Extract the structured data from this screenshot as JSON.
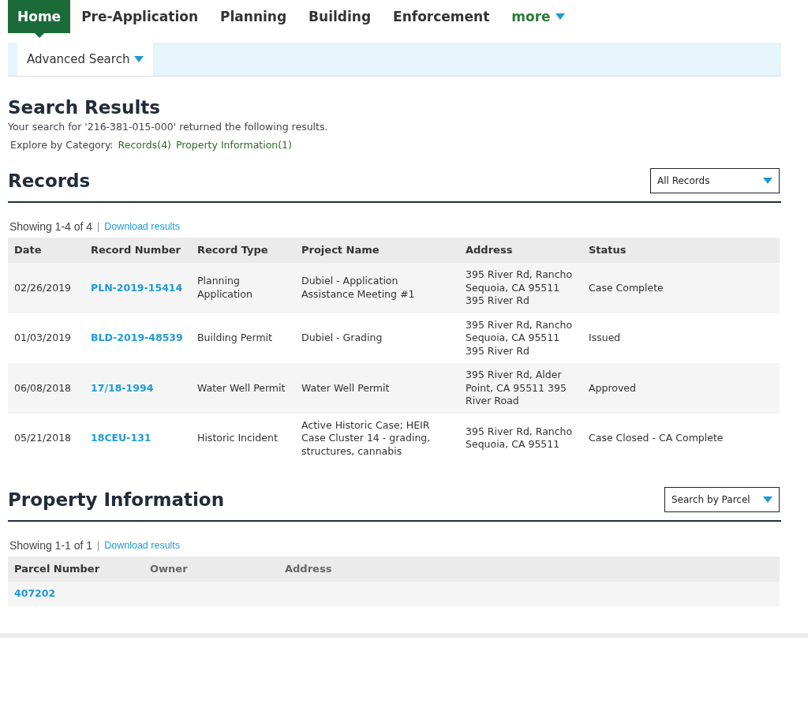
{
  "nav": {
    "tabs": [
      {
        "label": "Home",
        "kind": "link",
        "selected": true
      },
      {
        "label": "Pre-Application",
        "kind": "link",
        "selected": false
      },
      {
        "label": "Planning",
        "kind": "link",
        "selected": false
      },
      {
        "label": "Building",
        "kind": "link",
        "selected": false
      },
      {
        "label": "Enforcement",
        "kind": "link",
        "selected": false
      },
      {
        "label": "more",
        "kind": "menu",
        "selected": false
      }
    ],
    "subnav": {
      "label": "Advanced Search"
    }
  },
  "search_results": {
    "title": "Search Results",
    "summary": "Your search for '216-381-015-000' returned the following results.",
    "explore_label": "Explore by Category:",
    "categories": [
      "Records(4)",
      "Property Information(1)"
    ]
  },
  "records": {
    "title": "Records",
    "filter": "All Records",
    "showing": "Showing 1-4 of 4",
    "separator": "|",
    "download": "Download results",
    "columns": [
      "Date",
      "Record Number",
      "Record Type",
      "Project Name",
      "Address",
      "Status"
    ],
    "rows": [
      {
        "date": "02/26/2019",
        "number": "PLN-2019-15414",
        "type": "Planning Application",
        "project": "Dubiel - Application Assistance Meeting #1",
        "address": "395 River Rd, Rancho Sequoia, CA 95511 395 River Rd",
        "status": "Case Complete"
      },
      {
        "date": "01/03/2019",
        "number": "BLD-2019-48539",
        "type": "Building Permit",
        "project": "Dubiel - Grading",
        "address": "395 River Rd, Rancho Sequoia, CA 95511 395 River Rd",
        "status": "Issued"
      },
      {
        "date": "06/08/2018",
        "number": "17/18-1994",
        "type": "Water Well Permit",
        "project": "Water Well Permit",
        "address": "395 River Rd, Alder Point, CA 95511 395 River Road",
        "status": "Approved"
      },
      {
        "date": "05/21/2018",
        "number": "18CEU-131",
        "type": "Historic Incident",
        "project": "Active Historic Case; HEIR Case Cluster 14 - grading, structures, cannabis",
        "address": "395 River Rd, Rancho Sequoia, CA 95511",
        "status": "Case Closed - CA Complete"
      }
    ]
  },
  "property_information": {
    "title": "Property Information",
    "filter": "Search by Parcel",
    "showing": "Showing 1-1 of 1",
    "separator": "|",
    "download": "Download results",
    "columns": [
      "Parcel Number",
      "Owner",
      "Address"
    ],
    "rows": [
      {
        "parcel_number": "407202"
      }
    ]
  }
}
